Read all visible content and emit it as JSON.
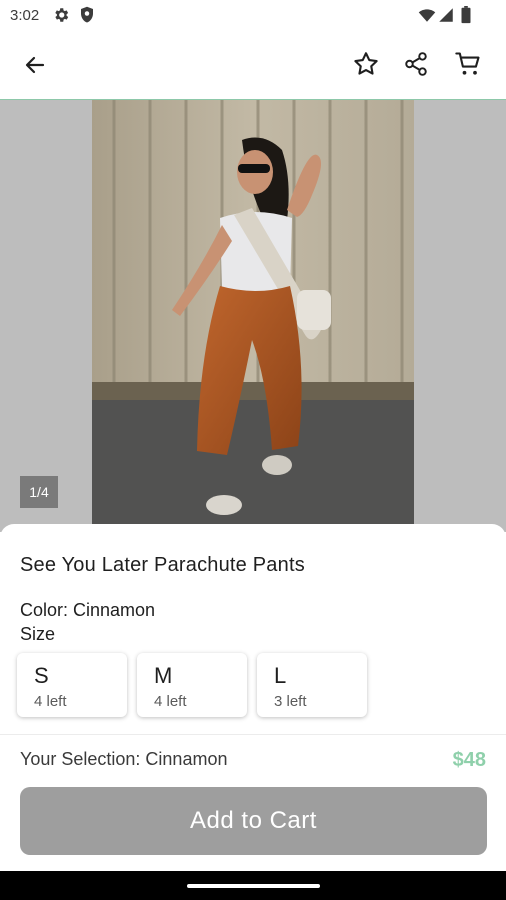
{
  "status_bar": {
    "time": "3:02",
    "icons": [
      "gear-icon",
      "shield-icon",
      "wifi-icon",
      "signal-icon",
      "battery-icon"
    ]
  },
  "app_bar": {
    "icons": [
      "back-arrow-icon",
      "star-icon",
      "share-icon",
      "cart-icon"
    ],
    "divider_color": "#8dc8a9"
  },
  "gallery": {
    "counter": "1/4"
  },
  "product": {
    "title": "See You Later Parachute Pants",
    "color_label": "Color: Cinnamon",
    "size_label": "Size",
    "sizes": [
      {
        "size": "S",
        "stock": "4 left"
      },
      {
        "size": "M",
        "stock": "4 left"
      },
      {
        "size": "L",
        "stock": "3 left"
      }
    ],
    "selection": "Your Selection: Cinnamon",
    "price": "$48",
    "add_to_cart": "Add to Cart"
  },
  "colors": {
    "price": "#8fd0ab",
    "button_disabled": "#9e9e9e"
  }
}
